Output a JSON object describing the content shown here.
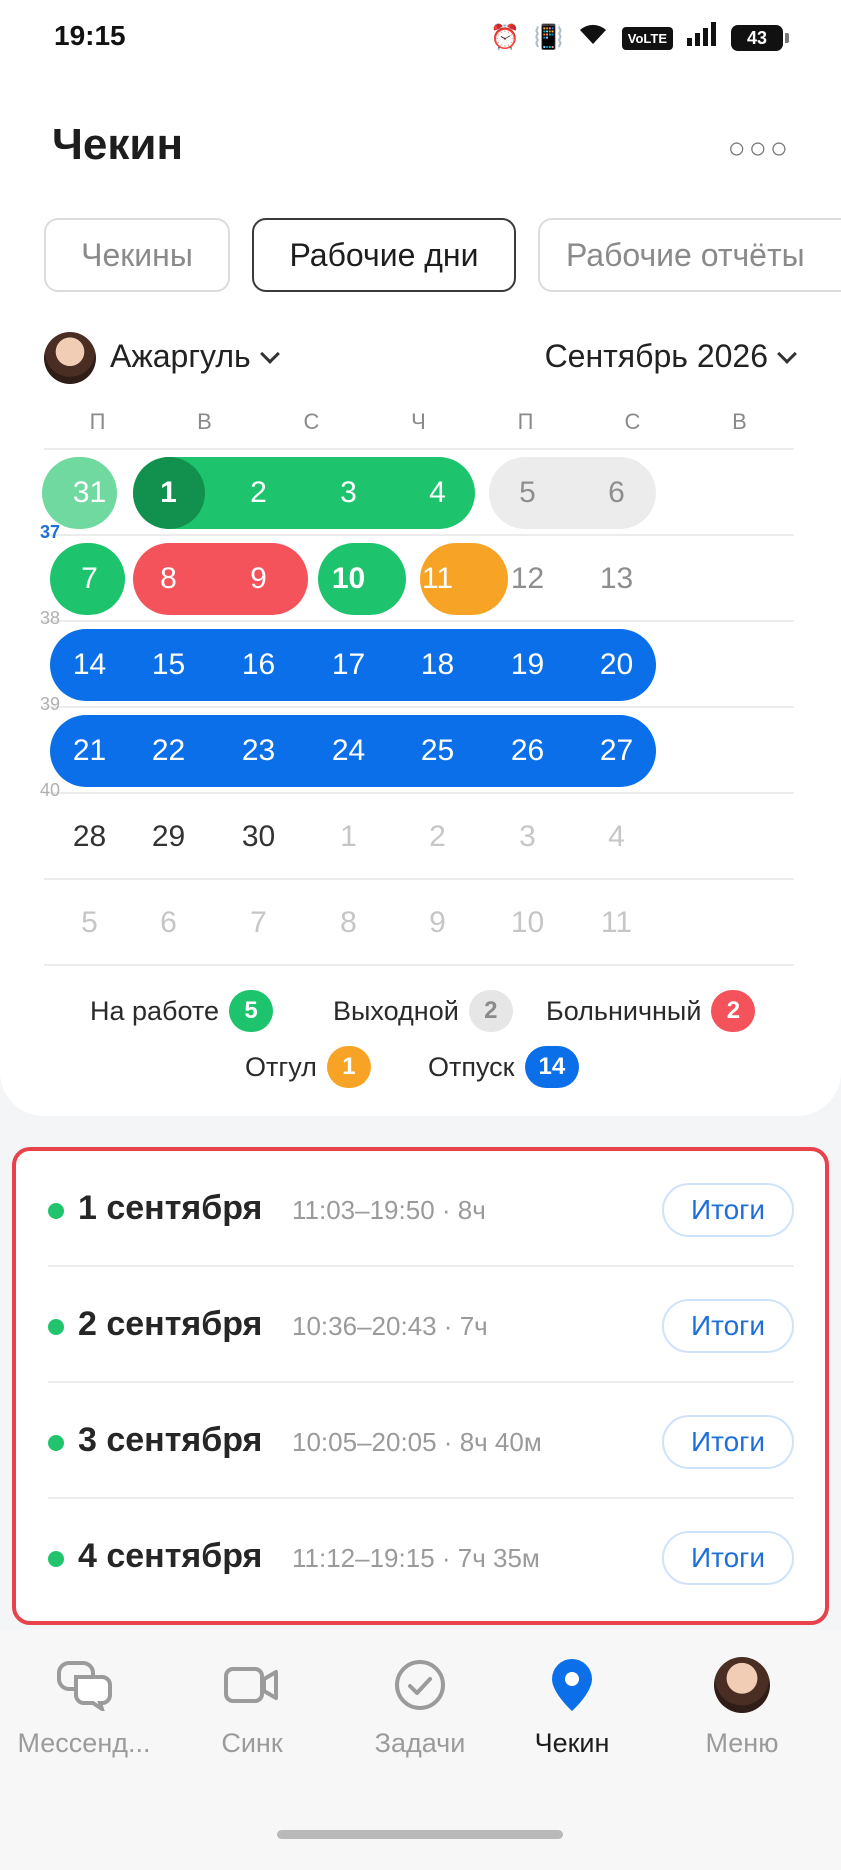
{
  "status": {
    "time": "19:15",
    "battery": "43",
    "network": "VoLTE"
  },
  "header": {
    "title": "Чекин",
    "more_icon": "more-icon"
  },
  "tabs": [
    {
      "label": "Чекины"
    },
    {
      "label": "Рабочие дни"
    },
    {
      "label": "Рабочие отчёты"
    }
  ],
  "user": {
    "name": "Ажаргуль"
  },
  "month": {
    "label": "Сентябрь 2026"
  },
  "calendar": {
    "weekdays": [
      "П",
      "В",
      "С",
      "Ч",
      "П",
      "С",
      "В"
    ],
    "weeks": [
      {
        "num": "",
        "days": [
          "31",
          "1",
          "2",
          "3",
          "4",
          "5",
          "6"
        ]
      },
      {
        "num": "37",
        "days": [
          "7",
          "8",
          "9",
          "10",
          "11",
          "12",
          "13"
        ]
      },
      {
        "num": "38",
        "days": [
          "14",
          "15",
          "16",
          "17",
          "18",
          "19",
          "20"
        ]
      },
      {
        "num": "39",
        "days": [
          "21",
          "22",
          "23",
          "24",
          "25",
          "26",
          "27"
        ]
      },
      {
        "num": "40",
        "days": [
          "28",
          "29",
          "30",
          "1",
          "2",
          "3",
          "4"
        ]
      },
      {
        "num": "",
        "days": [
          "5",
          "6",
          "7",
          "8",
          "9",
          "10",
          "11"
        ]
      }
    ]
  },
  "legend": {
    "work": {
      "label": "На работе",
      "count": "5",
      "color": "#1dc46d"
    },
    "dayoff": {
      "label": "Выходной",
      "count": "2",
      "color": "#e6e6e6"
    },
    "sick": {
      "label": "Больничный",
      "count": "2",
      "color": "#f4535b"
    },
    "leave": {
      "label": "Отгул",
      "count": "1",
      "color": "#f7a326"
    },
    "vacation": {
      "label": "Отпуск",
      "count": "14",
      "color": "#0a6fe8"
    }
  },
  "entries": [
    {
      "date": "1 сентября",
      "time": "11:03–19:50 · 8ч",
      "action": "Итоги"
    },
    {
      "date": "2 сентября",
      "time": "10:36–20:43 · 7ч",
      "action": "Итоги"
    },
    {
      "date": "3 сентября",
      "time": "10:05–20:05 · 8ч 40м",
      "action": "Итоги"
    },
    {
      "date": "4 сентября",
      "time": "11:12–19:15 · 7ч 35м",
      "action": "Итоги"
    }
  ],
  "nav": [
    {
      "label": "Мессенд...",
      "icon": "chat-icon"
    },
    {
      "label": "Синк",
      "icon": "video-icon"
    },
    {
      "label": "Задачи",
      "icon": "check-circle-icon"
    },
    {
      "label": "Чекин",
      "icon": "location-pin-icon"
    },
    {
      "label": "Меню",
      "icon": "avatar"
    }
  ]
}
